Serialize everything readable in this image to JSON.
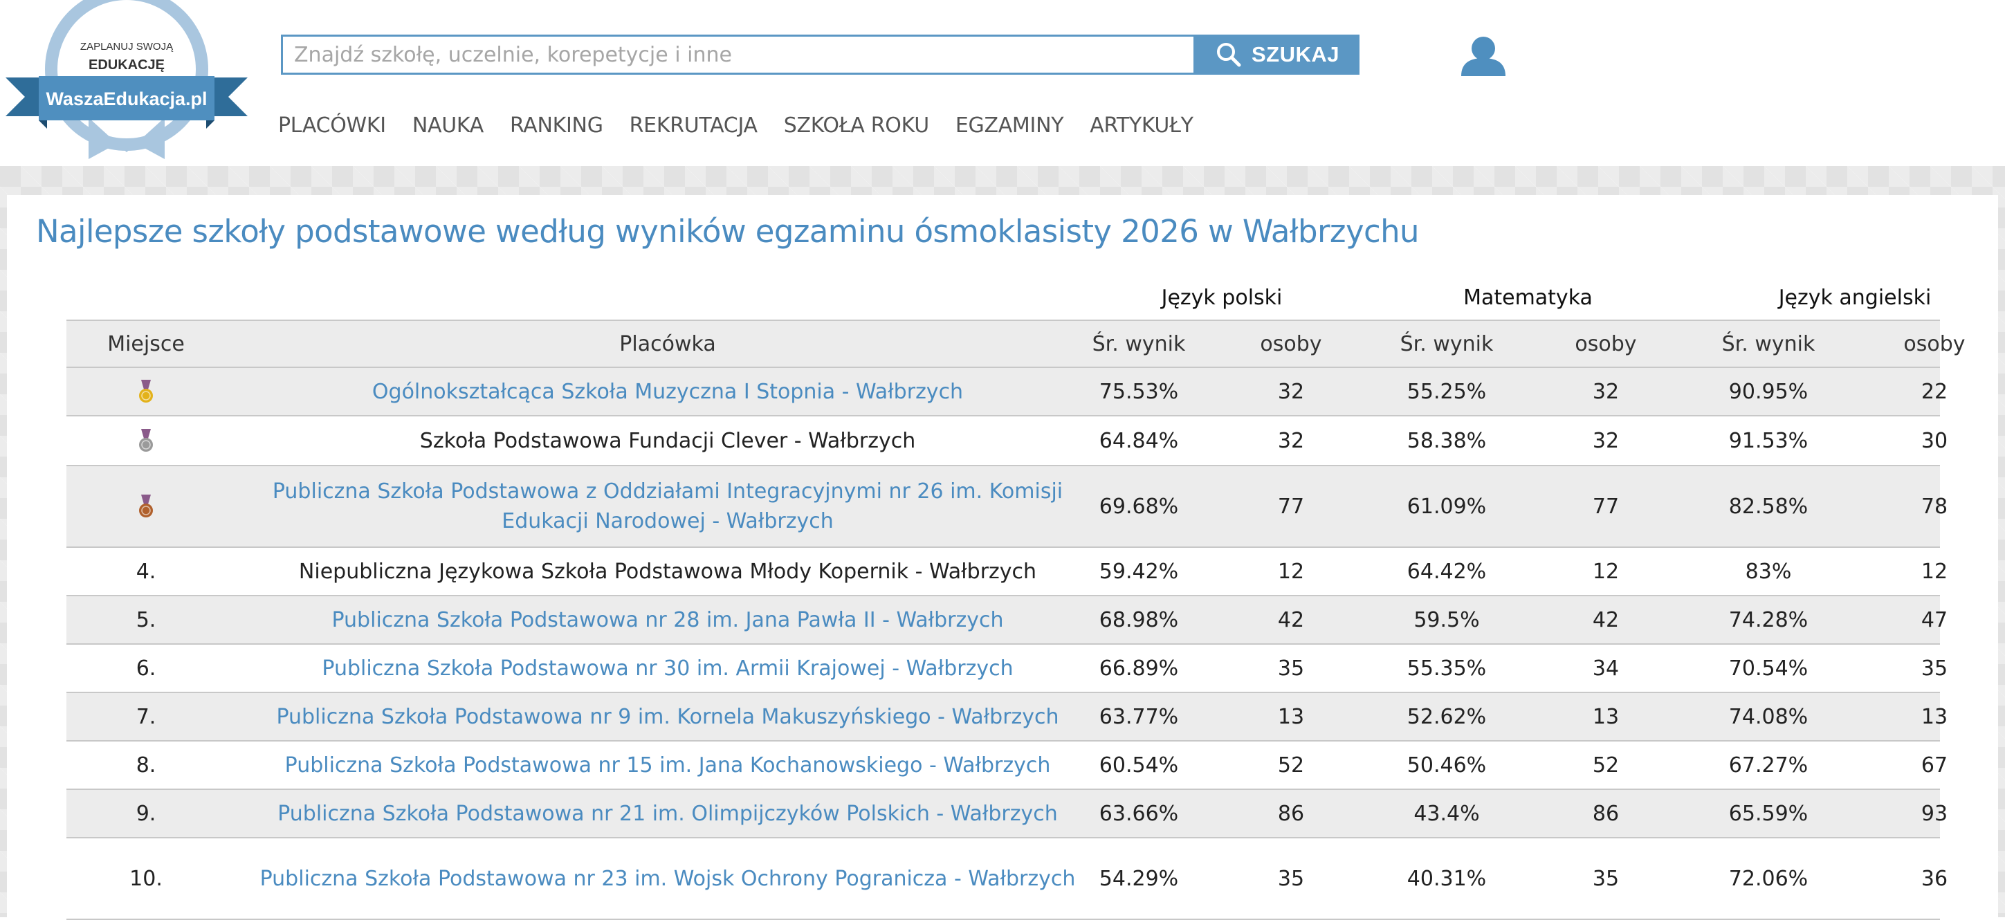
{
  "logo": {
    "line1": "ZAPLANUJ SWOJĄ",
    "line2": "EDUKACJĘ",
    "brand": "WaszaEdukacja.pl"
  },
  "search": {
    "placeholder": "Znajdź szkołę, uczelnie, korepetycje i inne",
    "button_label": "SZUKAJ",
    "icon": "search-icon"
  },
  "user": {
    "icon": "user-icon"
  },
  "nav": {
    "items": [
      "PLACÓWKI",
      "NAUKA",
      "RANKING",
      "REKRUTACJA",
      "SZKOŁA ROKU",
      "EGZAMINY",
      "ARTYKUŁY"
    ]
  },
  "page": {
    "title": "Najlepsze szkoły podstawowe według wyników egzaminu ósmoklasisty 2026 w Wałbrzychu"
  },
  "table": {
    "groups": [
      "Język polski",
      "Matematyka",
      "Język angielski"
    ],
    "headers": {
      "rank": "Miejsce",
      "name": "Placówka",
      "avg": "Śr. wynik",
      "people": "osoby"
    },
    "rows": [
      {
        "rank": "",
        "medal": "gold",
        "name": "Ogólnokształcąca Szkoła Muzyczna I Stopnia - Wałbrzych",
        "link": true,
        "pl": "75.53%",
        "pl_n": "32",
        "ma": "55.25%",
        "ma_n": "32",
        "en": "90.95%",
        "en_n": "22"
      },
      {
        "rank": "",
        "medal": "silver",
        "name": "Szkoła Podstawowa Fundacji Clever - Wałbrzych",
        "link": false,
        "pl": "64.84%",
        "pl_n": "32",
        "ma": "58.38%",
        "ma_n": "32",
        "en": "91.53%",
        "en_n": "30"
      },
      {
        "rank": "",
        "medal": "bronze",
        "name": "Publiczna Szkoła Podstawowa z Oddziałami Integracyjnymi nr 26 im. Komisji Edukacji Narodowej - Wałbrzych",
        "link": true,
        "pl": "69.68%",
        "pl_n": "77",
        "ma": "61.09%",
        "ma_n": "77",
        "en": "82.58%",
        "en_n": "78"
      },
      {
        "rank": "4.",
        "medal": "",
        "name": "Niepubliczna Językowa Szkoła Podstawowa Młody Kopernik - Wałbrzych",
        "link": false,
        "pl": "59.42%",
        "pl_n": "12",
        "ma": "64.42%",
        "ma_n": "12",
        "en": "83%",
        "en_n": "12"
      },
      {
        "rank": "5.",
        "medal": "",
        "name": "Publiczna Szkoła Podstawowa nr 28 im. Jana Pawła II - Wałbrzych",
        "link": true,
        "pl": "68.98%",
        "pl_n": "42",
        "ma": "59.5%",
        "ma_n": "42",
        "en": "74.28%",
        "en_n": "47"
      },
      {
        "rank": "6.",
        "medal": "",
        "name": "Publiczna Szkoła Podstawowa nr 30 im. Armii Krajowej - Wałbrzych",
        "link": true,
        "pl": "66.89%",
        "pl_n": "35",
        "ma": "55.35%",
        "ma_n": "34",
        "en": "70.54%",
        "en_n": "35"
      },
      {
        "rank": "7.",
        "medal": "",
        "name": "Publiczna Szkoła Podstawowa nr 9 im. Kornela Makuszyńskiego - Wałbrzych",
        "link": true,
        "pl": "63.77%",
        "pl_n": "13",
        "ma": "52.62%",
        "ma_n": "13",
        "en": "74.08%",
        "en_n": "13"
      },
      {
        "rank": "8.",
        "medal": "",
        "name": "Publiczna Szkoła Podstawowa nr 15 im. Jana Kochanowskiego - Wałbrzych",
        "link": true,
        "pl": "60.54%",
        "pl_n": "52",
        "ma": "50.46%",
        "ma_n": "52",
        "en": "67.27%",
        "en_n": "67"
      },
      {
        "rank": "9.",
        "medal": "",
        "name": "Publiczna Szkoła Podstawowa nr 21 im. Olimpijczyków Polskich - Wałbrzych",
        "link": true,
        "pl": "63.66%",
        "pl_n": "86",
        "ma": "43.4%",
        "ma_n": "86",
        "en": "65.59%",
        "en_n": "93"
      },
      {
        "rank": "10.",
        "medal": "",
        "name": "Publiczna Szkoła Podstawowa nr 23 im. Wojsk Ochrony Pogranicza - Wałbrzych",
        "link": true,
        "pl": "54.29%",
        "pl_n": "35",
        "ma": "40.31%",
        "ma_n": "35",
        "en": "72.06%",
        "en_n": "36"
      }
    ]
  },
  "colors": {
    "accent": "#5b97c4",
    "link": "#4a8bc0",
    "row_shade": "#ececec",
    "gold": "#e3b21b",
    "silver": "#9a9a9a",
    "bronze": "#b0602c",
    "ribbon": "#8a5a8a"
  }
}
